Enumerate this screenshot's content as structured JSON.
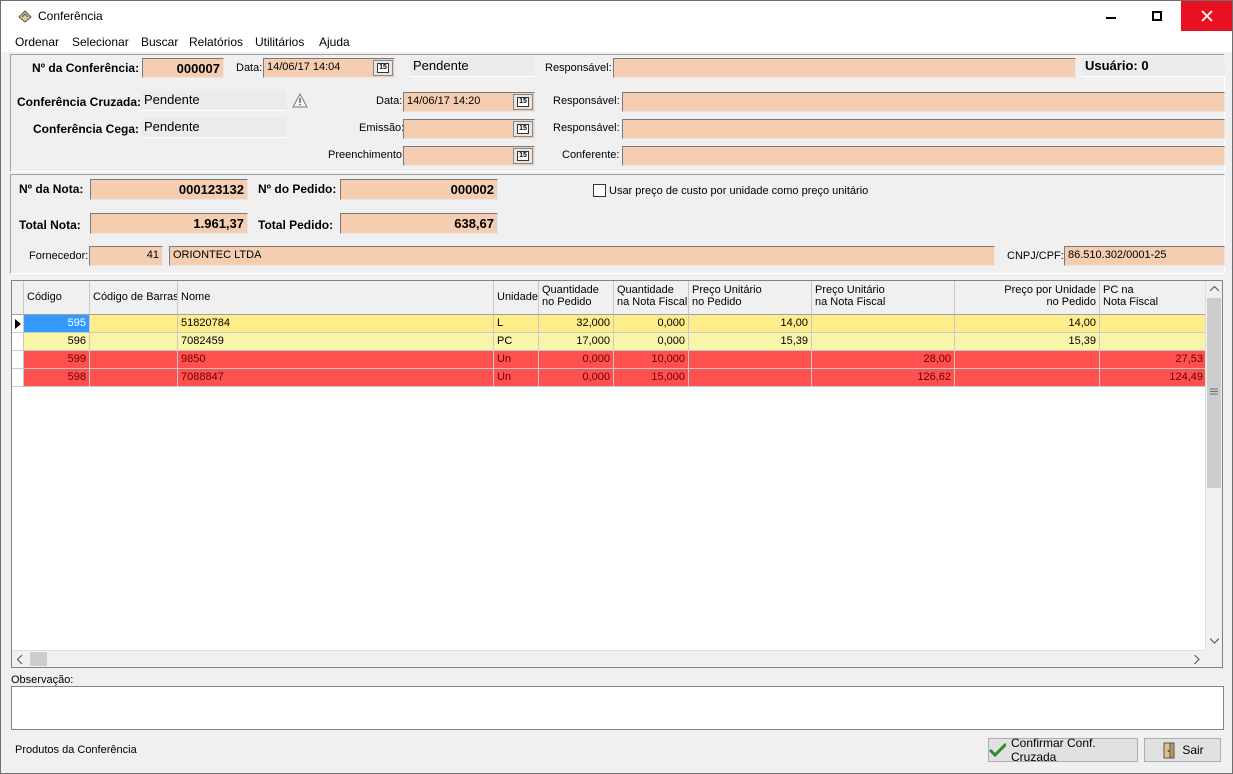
{
  "window": {
    "title": "Conferência"
  },
  "menu": [
    "Ordenar",
    "Selecionar",
    "Buscar",
    "Relatórios",
    "Utilitários",
    "Ajuda"
  ],
  "conferencia": {
    "numero_label": "Nº da Conferência:",
    "numero": "000007",
    "data_label": "Data:",
    "data": "14/06/17  14:04",
    "status": "Pendente",
    "responsavel_label": "Responsável:",
    "responsavel": "",
    "usuario": "Usuário: 0"
  },
  "cruzada": {
    "label": "Conferência Cruzada:",
    "status": "Pendente",
    "data_label": "Data:",
    "data": "14/06/17  14:20",
    "responsavel_label": "Responsável:",
    "responsavel": ""
  },
  "cega": {
    "label": "Conferência Cega:",
    "status": "Pendente",
    "emissao_label": "Emissão:",
    "emissao": "",
    "responsavel_label": "Responsável:",
    "responsavel": ""
  },
  "preenchimento": {
    "label": "Preenchimento:",
    "value": "",
    "conferente_label": "Conferente:",
    "conferente": ""
  },
  "nota": {
    "numero_label": "Nº da Nota:",
    "numero": "000123132",
    "pedido_label": "Nº do Pedido:",
    "pedido": "000002",
    "total_nota_label": "Total Nota:",
    "total_nota": "1.961,37",
    "total_pedido_label": "Total Pedido:",
    "total_pedido": "638,67",
    "checkbox_label": "Usar preço de custo por unidade como preço unitário",
    "fornecedor_label": "Fornecedor:",
    "fornecedor_codigo": "41",
    "fornecedor_nome": "ORIONTEC LTDA",
    "cnpj_label": "CNPJ/CPF:",
    "cnpj": "86.510.302/0001-25"
  },
  "grid": {
    "headers": [
      [
        "Código",
        ""
      ],
      [
        "Código de Barras",
        ""
      ],
      [
        "Nome",
        ""
      ],
      [
        "Unidade",
        ""
      ],
      [
        "Quantidade",
        "no Pedido"
      ],
      [
        "Quantidade",
        "na Nota Fiscal"
      ],
      [
        "Preço Unitário",
        "no Pedido"
      ],
      [
        "Preço Unitário",
        "na Nota Fiscal"
      ],
      [
        "Preço por Unidade",
        "no Pedido"
      ],
      [
        "PC na",
        "Nota Fiscal"
      ]
    ],
    "rows": [
      {
        "codigo": "595",
        "barras": "",
        "nome": "51820784",
        "unidade": "L",
        "qtd_pedido": "32,000",
        "qtd_nota": "0,000",
        "pu_pedido": "14,00",
        "pu_nota": "",
        "ppu_pedido": "14,00",
        "pc_nota": ""
      },
      {
        "codigo": "596",
        "barras": "",
        "nome": "7082459",
        "unidade": "PC",
        "qtd_pedido": "17,000",
        "qtd_nota": "0,000",
        "pu_pedido": "15,39",
        "pu_nota": "",
        "ppu_pedido": "15,39",
        "pc_nota": ""
      },
      {
        "codigo": "599",
        "barras": "",
        "nome": "9850",
        "unidade": "Un",
        "qtd_pedido": "0,000",
        "qtd_nota": "10,000",
        "pu_pedido": "",
        "pu_nota": "28,00",
        "ppu_pedido": "",
        "pc_nota": "27,53"
      },
      {
        "codigo": "598",
        "barras": "",
        "nome": "7088847",
        "unidade": "Un",
        "qtd_pedido": "0,000",
        "qtd_nota": "15,000",
        "pu_pedido": "",
        "pu_nota": "126,62",
        "ppu_pedido": "",
        "pc_nota": "124,49"
      }
    ]
  },
  "observacao": {
    "label": "Observação:",
    "value": ""
  },
  "footer": {
    "status": "Produtos da Conferência",
    "confirm_label": "Confirmar Conf. Cruzada",
    "exit_label": "Sair"
  },
  "colors": {
    "field": "#f5cdb0",
    "row_yellow": "#ffec8b",
    "row_red": "#ff5050",
    "close": "#e81123"
  }
}
